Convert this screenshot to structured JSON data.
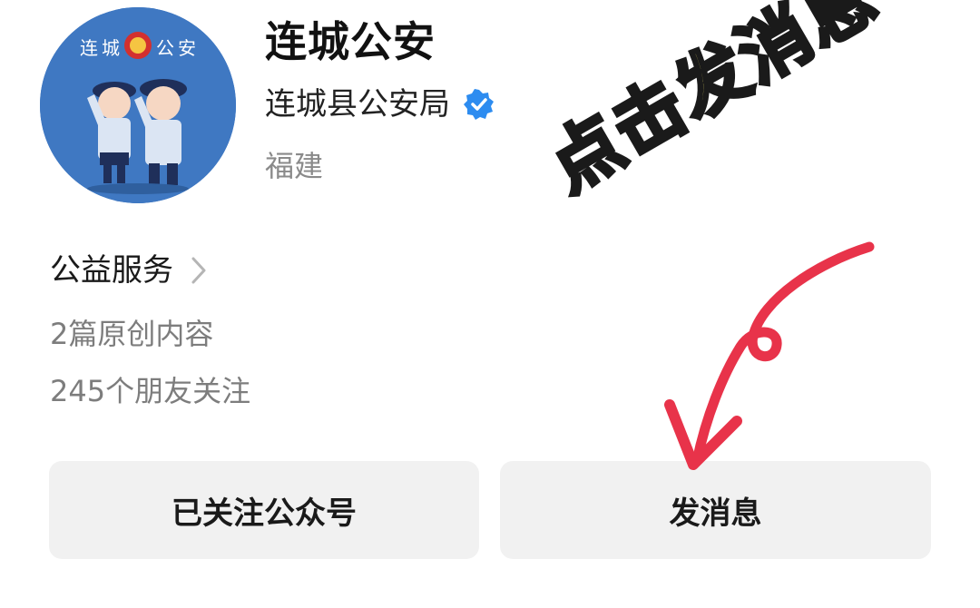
{
  "account": {
    "name": "连城公安",
    "organization": "连城县公安局",
    "region": "福建",
    "avatar_text": "连城公安"
  },
  "service": {
    "label": "公益服务"
  },
  "stats": {
    "original_content": "2篇原创内容",
    "followers": "245个朋友关注"
  },
  "buttons": {
    "follow_label": "已关注公众号",
    "message_label": "发消息"
  },
  "overlay": {
    "callout_text": "点击发消息"
  },
  "colors": {
    "avatar_bg": "#3f78c2",
    "verified_badge": "#2d8cf0",
    "callout_fill": "#f5e86b",
    "arrow": "#e8334a",
    "button_bg": "#f1f1f1"
  },
  "icons": {
    "verified": "verified-badge-icon",
    "chevron": "chevron-right-icon",
    "arrow": "curved-arrow-annotation"
  }
}
